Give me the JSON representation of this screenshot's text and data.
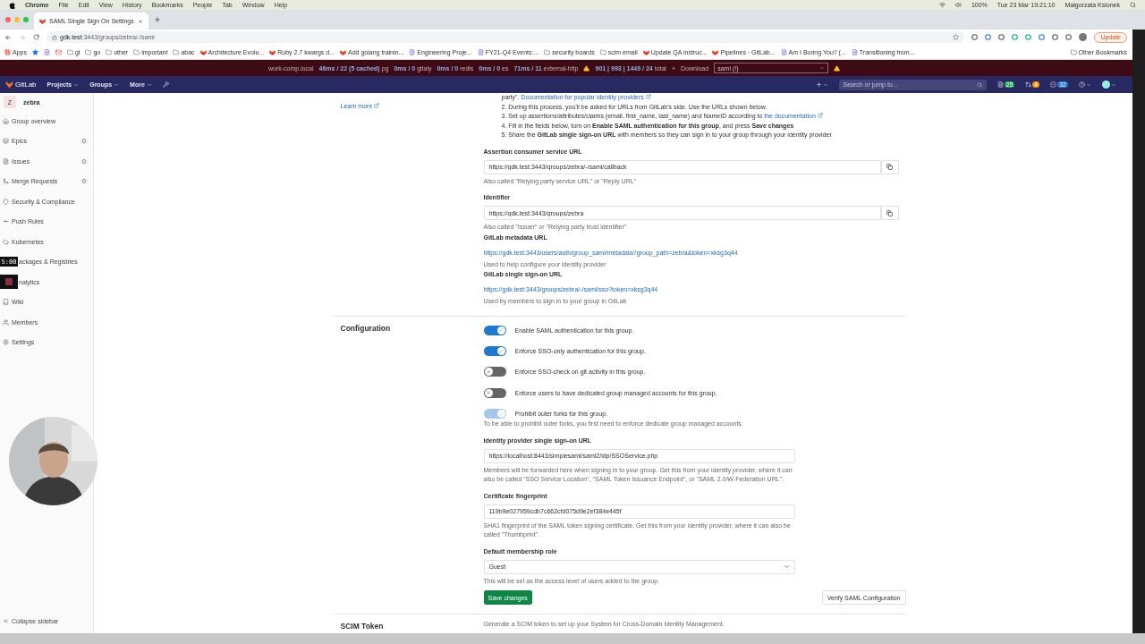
{
  "menu_bar": {
    "app": "Chrome",
    "menus": [
      "File",
      "Edit",
      "View",
      "History",
      "Bookmarks",
      "People",
      "Tab",
      "Window",
      "Help"
    ],
    "battery": "100%",
    "clock": "Tue 23 Mar  19:21:10",
    "user": "Małgorzata Ksionek"
  },
  "browser": {
    "tab_title": "SAML Single Sign On Settings",
    "url_host": "gdk.test",
    "url_path": ":3443/groups/zebra/-/saml",
    "update_label": "Update",
    "bookmarks": [
      {
        "kind": "apps",
        "label": "Apps"
      },
      {
        "kind": "star"
      },
      {
        "kind": "page"
      },
      {
        "kind": "mail"
      },
      {
        "kind": "folder",
        "label": "gl"
      },
      {
        "kind": "folder",
        "label": "go"
      },
      {
        "kind": "folder",
        "label": "other"
      },
      {
        "kind": "folder",
        "label": "important"
      },
      {
        "kind": "folder",
        "label": "abac"
      },
      {
        "kind": "fox",
        "label": "Architecture Evolu..."
      },
      {
        "kind": "fox",
        "label": "Ruby 2.7 kwargs d..."
      },
      {
        "kind": "fox",
        "label": "Add golang trainin..."
      },
      {
        "kind": "page",
        "label": "Engineering Proje..."
      },
      {
        "kind": "page",
        "label": "FY21-Q4 Events:..."
      },
      {
        "kind": "folder",
        "label": "security boards"
      },
      {
        "kind": "folder",
        "label": "scim email"
      },
      {
        "kind": "fox",
        "label": "Update QA instruc..."
      },
      {
        "kind": "fox",
        "label": "Pipelines · GitLab..."
      },
      {
        "kind": "page",
        "label": "Am I Boring You? (..."
      },
      {
        "kind": "page",
        "label": "Transitioning from..."
      }
    ],
    "other_bookmarks": "Other Bookmarks"
  },
  "perf_bar": {
    "host": "work-comp.local",
    "metrics": [
      {
        "value": "46ms / 22 (5 cached)",
        "name": "pg"
      },
      {
        "value": "0ms / 0",
        "name": "gitaly"
      },
      {
        "value": "0ms / 0",
        "name": "redis"
      },
      {
        "value": "0ms / 0",
        "name": "es"
      },
      {
        "value": "71ms / 11",
        "name": "external-http"
      }
    ],
    "total_value": "901 | 993 | 1449 / 24",
    "total_label": "total",
    "plus": "+",
    "download": "Download",
    "request": "saml (!)"
  },
  "navbar": {
    "brand": "GitLab",
    "menus": [
      "Projects",
      "Groups",
      "More"
    ],
    "search_placeholder": "Search or jump to...",
    "counts": [
      "25",
      "4",
      "32"
    ]
  },
  "sidebar": {
    "avatar": "Z",
    "group": "zebra",
    "items": [
      {
        "label": "Group overview",
        "covered": false
      },
      {
        "label": "Epics",
        "count": "0",
        "covered": false
      },
      {
        "label": "Issues",
        "count": "0",
        "covered": false
      },
      {
        "label": "Merge Requests",
        "count": "0",
        "covered": false
      },
      {
        "label": "Security & Compliance",
        "covered": false
      },
      {
        "label": "Push Rules",
        "covered": false
      },
      {
        "label": "Kubernetes",
        "covered": false
      },
      {
        "label": "ackages & Registries",
        "covered": true
      },
      {
        "label": "nalytics",
        "covered": true
      },
      {
        "label": "Wiki",
        "covered": false
      },
      {
        "label": "Members",
        "covered": false
      },
      {
        "label": "Settings",
        "covered": false
      }
    ],
    "collapse": "Collapse sidebar"
  },
  "recorder": {
    "timer": "5:00"
  },
  "saml": {
    "learn_more": "Learn more",
    "steps": [
      {
        "text": "party\".",
        "link": "Documentation for popular identity providers"
      },
      {
        "number": "2.",
        "text": "During this process, you'll be asked for URLs from GitLab's side. Use the URLs shown below."
      },
      {
        "number": "3.",
        "text": "Set up assertions/attributes/claims (email, first_name, last_name) and NameID according to",
        "link": "the documentation"
      },
      {
        "number": "4.",
        "text": "Fill in the fields below, turn on **Enable SAML authentication for this group**, and press **Save changes**"
      },
      {
        "number": "5.",
        "text": "Share the **GitLab single sign-on URL** with members so they can sign in to your group through your identity provider"
      }
    ],
    "copy_fields": [
      {
        "label": "Assertion consumer service URL",
        "value": "https://gdk.test:3443/groups/zebra/-/saml/callback",
        "help": "Also called \"Relying party service URL\" or \"Reply URL\""
      },
      {
        "label": "Identifier",
        "value": "https://gdk.test:3443/groups/zebra",
        "help": "Also called \"Issuer\" or \"Relying party trust identifier\""
      }
    ],
    "links": [
      {
        "label": "GitLab metadata URL",
        "url": "https://gdk.test:3443/users/auth/group_saml/metadata?group_path=zebra&token=xksg3q44",
        "help": "Used to help configure your identity provider"
      },
      {
        "label": "GitLab single sign-on URL",
        "url": "https://gdk.test:3443/groups/zebra/-/saml/sso?token=xksg3q44",
        "help": "Used by members to sign in to your group in GitLab"
      }
    ]
  },
  "configuration": {
    "title": "Configuration",
    "toggles": [
      {
        "label": "Enable SAML authentication for this group.",
        "on": true,
        "disabled": false
      },
      {
        "label": "Enforce SSO-only authentication for this group.",
        "on": true,
        "disabled": false
      },
      {
        "label": "Enforce SSO-check on git activity in this group.",
        "on": false,
        "disabled": false
      },
      {
        "label": "Enforce users to have dedicated group managed accounts for this group.",
        "on": false,
        "disabled": false
      },
      {
        "label": "Prohibit outer forks for this group.",
        "on": true,
        "disabled": true
      }
    ],
    "toggle_help": "To be able to prohibit outer forks, you first need to enforce dedicate group managed accounts.",
    "fields": [
      {
        "label": "Identity provider single sign-on URL",
        "value": "https://localhost:8443/simplesaml/saml2/idp/SSOService.php",
        "help": "Members will be forwarded here when signing in to your group. Get this from your identity provider, where it can also be called \"SSO Service Location\", \"SAML Token Issuance Endpoint\", or \"SAML 2.0/W-Federation URL\"."
      },
      {
        "label": "Certificate fingerprint",
        "value": "119b9e027959cdb7c662cfd075d9e2ef384e445f",
        "help": "SHA1 fingerprint of the SAML token signing certificate. Get this from your identity provider, where it can also be called \"Thumbprint\"."
      }
    ],
    "role": {
      "label": "Default membership role",
      "value": "Guest",
      "help": "This will be set as the access level of users added to the group."
    },
    "save": "Save changes",
    "verify": "Verify SAML Configuration"
  },
  "scim": {
    "title": "SCIM Token",
    "text": "Generate a SCIM token to set up your System for Cross-Domain Identity Management."
  }
}
